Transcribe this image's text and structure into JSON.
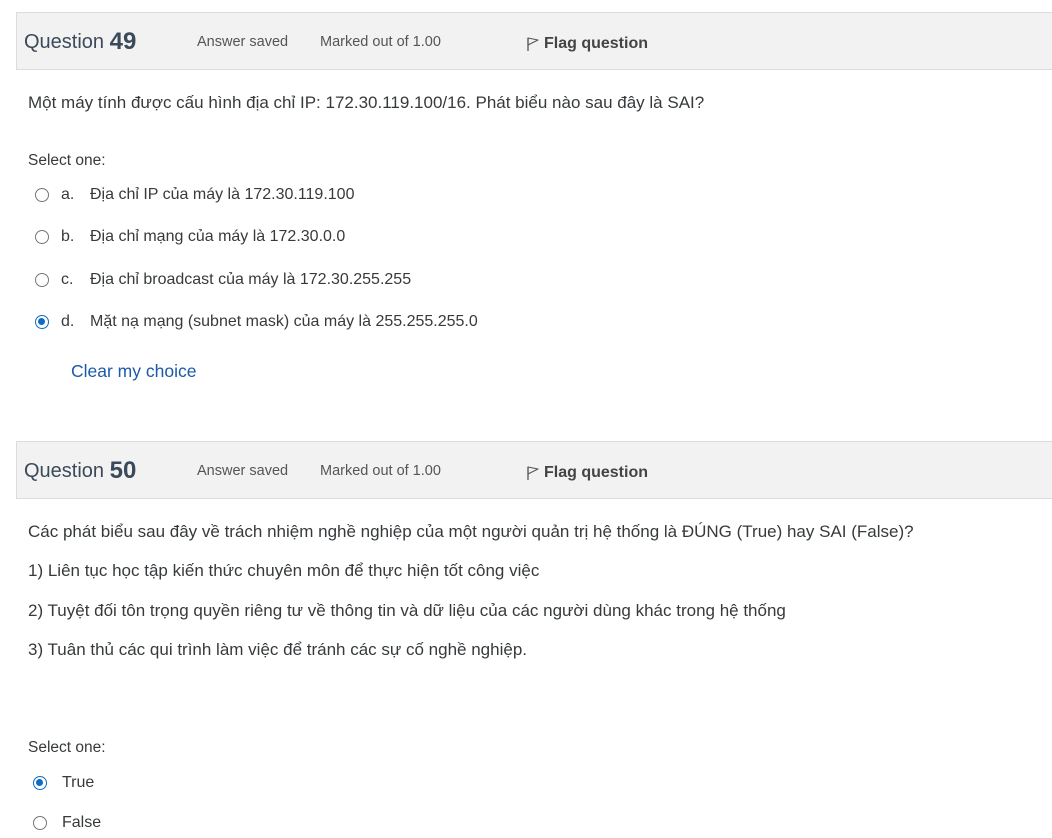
{
  "questions": [
    {
      "title_prefix": "Question",
      "number": "49",
      "state": "Answer saved",
      "grade": "Marked out of 1.00",
      "flag_label": "Flag question",
      "text_lines": [
        "Một máy tính được cấu hình địa chỉ IP: 172.30.119.100/16. Phát biểu nào sau đây là SAI?"
      ],
      "select_label": "Select one:",
      "options": [
        {
          "letter": "a.",
          "text": "Địa chỉ IP của máy là 172.30.119.100",
          "selected": false
        },
        {
          "letter": "b.",
          "text": "Địa chỉ mạng của máy là 172.30.0.0",
          "selected": false
        },
        {
          "letter": "c.",
          "text": "Địa chỉ broadcast của máy là 172.30.255.255",
          "selected": false
        },
        {
          "letter": "d.",
          "text": "Mặt nạ mạng (subnet mask) của máy là 255.255.255.0",
          "selected": true
        }
      ],
      "clear_label": "Clear my choice"
    },
    {
      "title_prefix": "Question",
      "number": "50",
      "state": "Answer saved",
      "grade": "Marked out of 1.00",
      "flag_label": "Flag question",
      "text_lines": [
        "Các phát biểu sau đây về trách nhiệm nghề nghiệp của một người quản trị hệ thống là ĐÚNG (True) hay SAI (False)?",
        "1) Liên tục học tập kiến thức chuyên môn để thực hiện tốt công việc",
        "2) Tuyệt đối tôn trọng quyền riêng tư về thông tin và dữ liệu của các người dùng khác trong hệ thống",
        "3) Tuân thủ các qui trình làm việc để tránh các sự cố nghề nghiệp."
      ],
      "select_label": "Select one:",
      "options": [
        {
          "text": "True",
          "selected": true
        },
        {
          "text": "False",
          "selected": false
        }
      ]
    }
  ],
  "colors": {
    "accent": "#0f6cbf",
    "link": "#1a5aa6",
    "header_bg": "#f2f2f2"
  },
  "icons": {
    "flag": "flag-icon",
    "radio": "radio-icon"
  }
}
